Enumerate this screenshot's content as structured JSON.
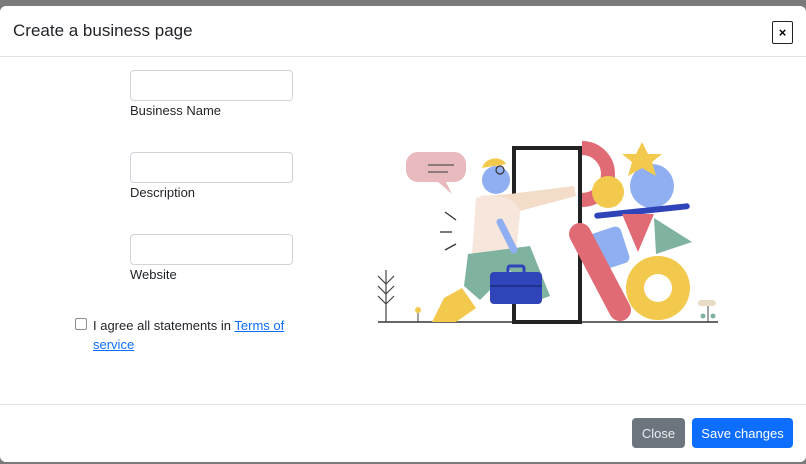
{
  "modal": {
    "title": "Create a business page",
    "close_x_label": "×"
  },
  "form": {
    "fields": [
      {
        "label": "Business Name",
        "value": ""
      },
      {
        "label": "Description",
        "value": ""
      },
      {
        "label": "Website",
        "value": ""
      }
    ],
    "agree": {
      "checked": false,
      "text": "I agree all statements in ",
      "link_text": "Terms of service"
    }
  },
  "illustration": {
    "icon": "person-exiting-door-illustration"
  },
  "footer": {
    "close_label": "Close",
    "save_label": "Save changes"
  },
  "colors": {
    "primary": "#0d6efd",
    "secondary": "#6c757d",
    "backdrop": "#7a7a7a"
  }
}
